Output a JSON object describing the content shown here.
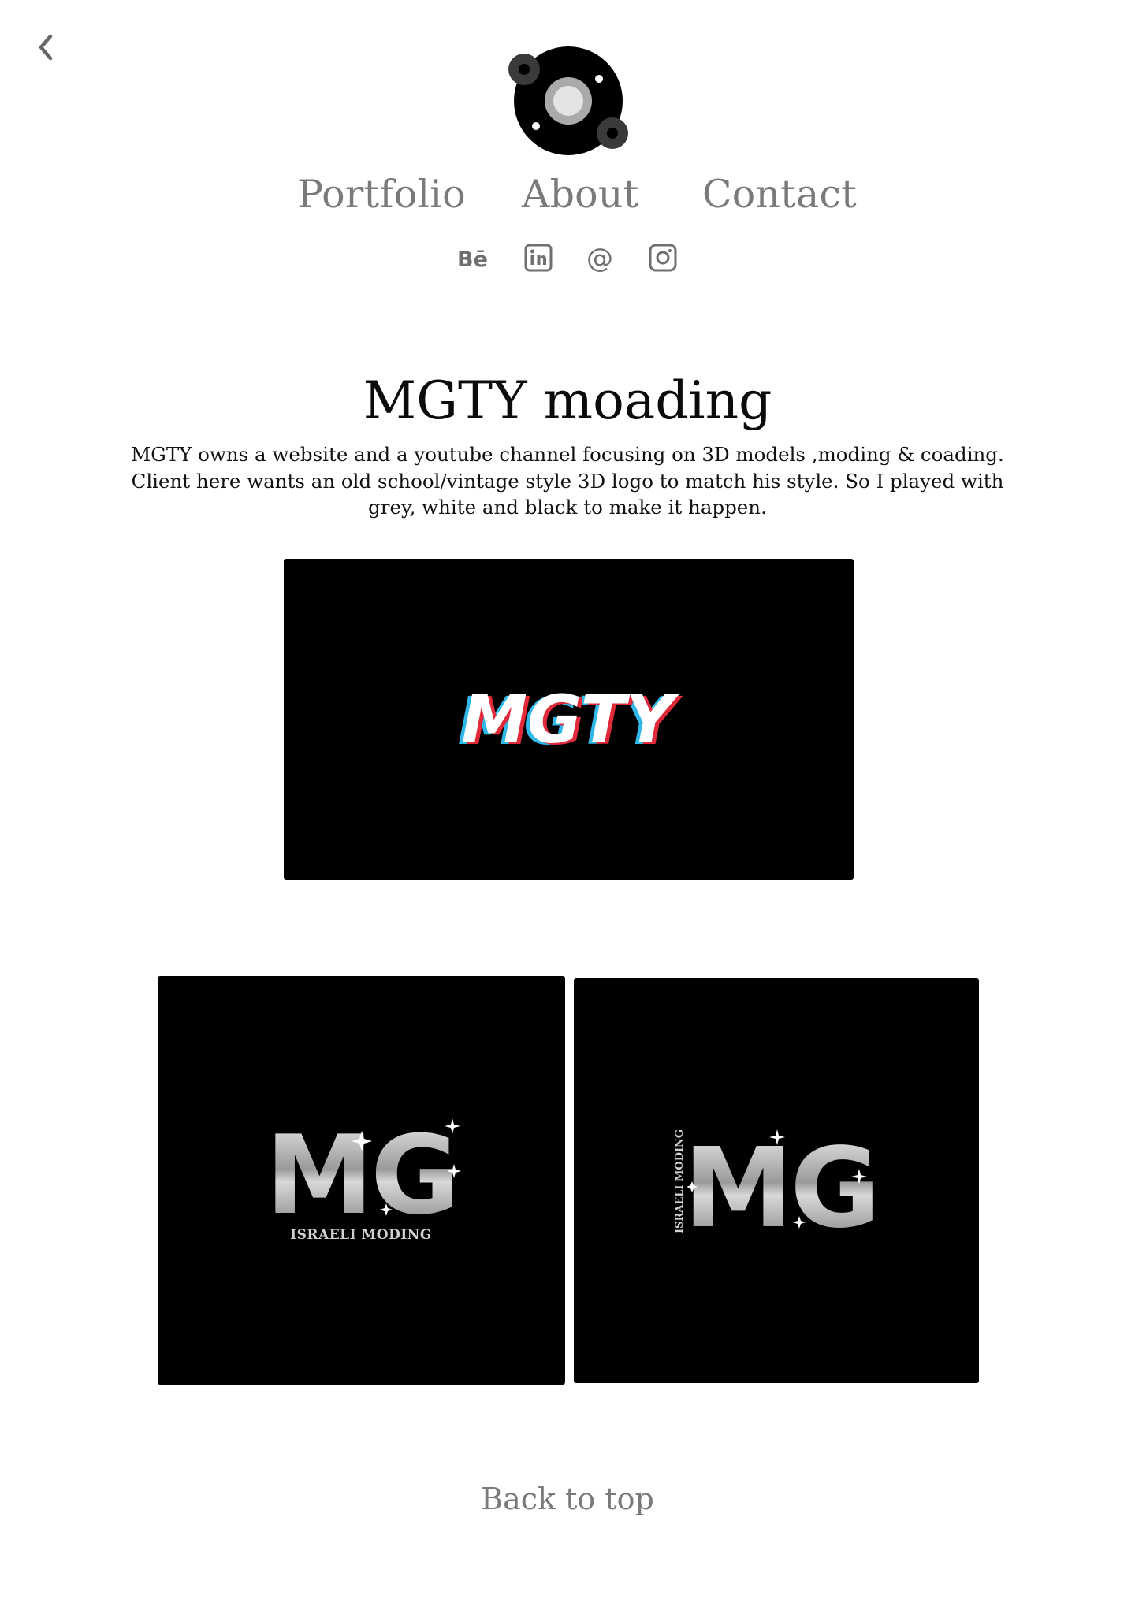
{
  "header": {
    "back_icon": "chevron-left-icon",
    "logo_icon": "vinyl-disc-logo-icon",
    "nav": [
      {
        "label": "Portfolio"
      },
      {
        "label": "About"
      },
      {
        "label": "Contact"
      }
    ],
    "social": [
      {
        "icon": "behance-icon"
      },
      {
        "icon": "linkedin-icon"
      },
      {
        "icon": "email-at-icon"
      },
      {
        "icon": "instagram-icon"
      }
    ]
  },
  "project": {
    "title": "MGTY moading",
    "description": "MGTY owns a website and a youtube channel focusing on 3D models ,moding & coading. Client here wants an old school/vintage style 3D logo to match his style. So I played with grey, white and black to make it happen.",
    "images": [
      {
        "logo_text": "MGTY"
      },
      {
        "logo_text": "MG",
        "tagline": "ISRAELI MODING"
      },
      {
        "logo_text": "MG",
        "tagline": "ISRAELI MODING"
      }
    ]
  },
  "footer": {
    "back_to_top": "Back to top"
  },
  "colors": {
    "nav_text": "#7a7a7a",
    "image_bg": "#000000",
    "accent_red": "#e02a3a",
    "accent_cyan": "#2fb8e8"
  }
}
